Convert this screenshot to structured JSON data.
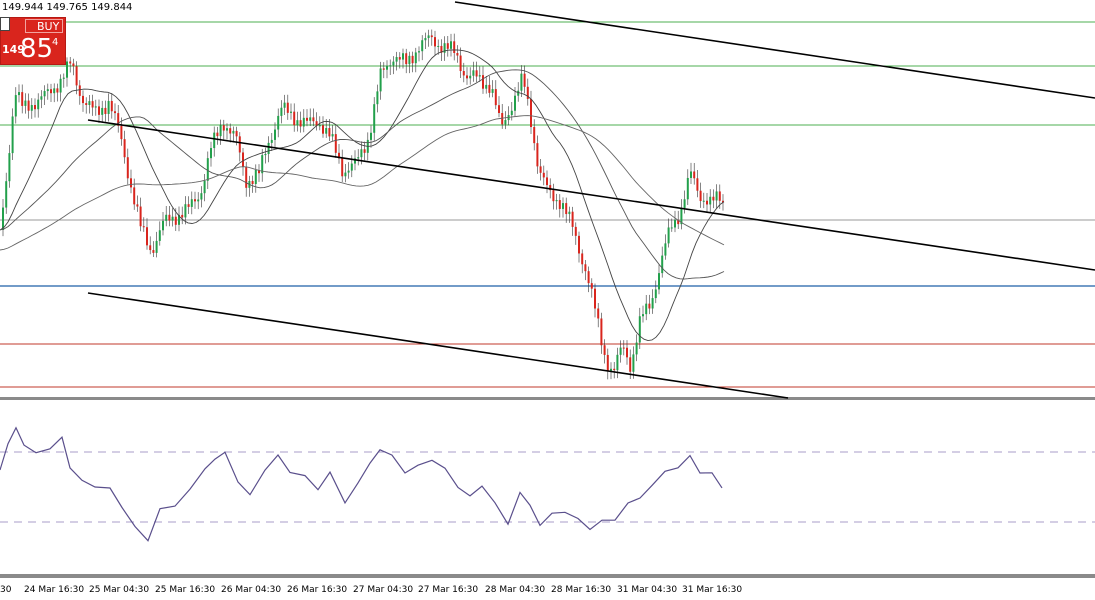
{
  "ohlc_readout": "149.944 149.765 149.844",
  "buy_panel": {
    "label": "BUY",
    "price_prefix": "149",
    "price_big": "85",
    "price_sup": "4"
  },
  "x_axis_labels": [
    "30",
    "24 Mar 16:30",
    "25 Mar 04:30",
    "25 Mar 16:30",
    "26 Mar 04:30",
    "26 Mar 16:30",
    "27 Mar 04:30",
    "27 Mar 16:30",
    "28 Mar 04:30",
    "28 Mar 16:30",
    "31 Mar 04:30",
    "31 Mar 16:30"
  ],
  "colors": {
    "bull": "#22a04b",
    "bear": "#d9251d",
    "green_levels": "#4caf50",
    "red_levels": "#c0392b",
    "blue_level": "#1f5fa6",
    "oscillator": "#5a4f8c",
    "trendlines": "#000000"
  }
}
